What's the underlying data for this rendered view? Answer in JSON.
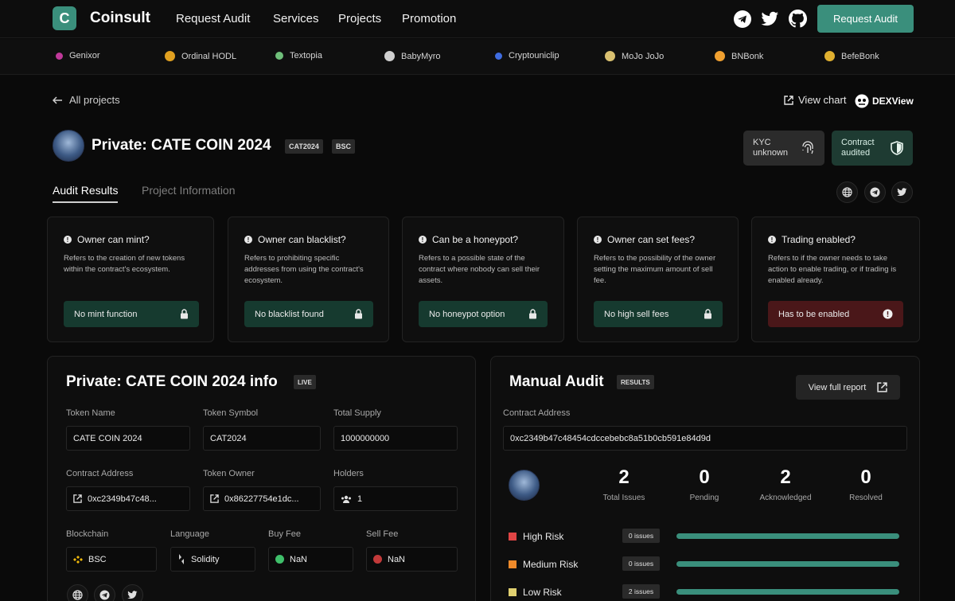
{
  "nav": {
    "brand": "Coinsult",
    "links": [
      "Request Audit",
      "Services",
      "Projects",
      "Promotion"
    ],
    "cta": "Request Audit"
  },
  "ticker": [
    {
      "name": "Genixor",
      "color": "#c0399a"
    },
    {
      "name": "Ordinal HODL",
      "color": "#e0a020"
    },
    {
      "name": "Textopia",
      "color": "#6fbf7a"
    },
    {
      "name": "BabyMyro",
      "color": "#cfcfcf"
    },
    {
      "name": "Cryptouniclip",
      "color": "#3f6ce0"
    },
    {
      "name": "MoJo JoJo",
      "color": "#d9c070"
    },
    {
      "name": "BNBonk",
      "color": "#f0a030"
    },
    {
      "name": "BefeBonk",
      "color": "#e0b030"
    }
  ],
  "header": {
    "back": "All projects",
    "view_chart": "View chart",
    "dexview": "DEXView",
    "title": "Private: CATE COIN 2024",
    "tags": [
      "CAT2024",
      "BSC"
    ],
    "kyc_line1": "KYC",
    "kyc_line2": "unknown",
    "contract_line1": "Contract",
    "contract_line2": "audited"
  },
  "tabs": [
    "Audit Results",
    "Project Information"
  ],
  "checks": [
    {
      "title": "Owner can mint?",
      "desc": "Refers to the creation of new tokens within the contract's ecosystem.",
      "status": "No mint function",
      "ok": true
    },
    {
      "title": "Owner can blacklist?",
      "desc": "Refers to prohibiting specific addresses from using the contract's ecosystem.",
      "status": "No blacklist found",
      "ok": true
    },
    {
      "title": "Can be a honeypot?",
      "desc": "Refers to a possible state of the contract where nobody can sell their assets.",
      "status": "No honeypot option",
      "ok": true
    },
    {
      "title": "Owner can set fees?",
      "desc": "Refers to the possibility of the owner setting the maximum amount of sell fee.",
      "status": "No high sell fees",
      "ok": true
    },
    {
      "title": "Trading enabled?",
      "desc": "Refers to if the owner needs to take action to enable trading, or if trading is enabled already.",
      "status": "Has to be enabled",
      "ok": false
    }
  ],
  "info": {
    "title": "Private: CATE COIN 2024 info",
    "tag": "LIVE",
    "token_name_label": "Token Name",
    "token_name": "CATE COIN 2024",
    "token_symbol_label": "Token Symbol",
    "token_symbol": "CAT2024",
    "total_supply_label": "Total Supply",
    "total_supply": "1000000000",
    "contract_label": "Contract Address",
    "contract": "0xc2349b47c48...",
    "owner_label": "Token Owner",
    "owner": "0x86227754e1dc...",
    "holders_label": "Holders",
    "holders": "1",
    "blockchain_label": "Blockchain",
    "blockchain": "BSC",
    "language_label": "Language",
    "language": "Solidity",
    "buy_fee_label": "Buy Fee",
    "buy_fee": "NaN",
    "sell_fee_label": "Sell Fee",
    "sell_fee": "NaN"
  },
  "audit": {
    "title": "Manual Audit",
    "tag": "RESULTS",
    "full_report": "View full report",
    "contract_label": "Contract Address",
    "contract": "0xc2349b47c48454cdccebebc8a51b0cb591e84d9d",
    "stats": [
      {
        "value": "2",
        "label": "Total Issues"
      },
      {
        "value": "0",
        "label": "Pending"
      },
      {
        "value": "2",
        "label": "Acknowledged"
      },
      {
        "value": "0",
        "label": "Resolved"
      }
    ],
    "risks": [
      {
        "label": "High Risk",
        "count": "0 issues",
        "color": "#e04545"
      },
      {
        "label": "Medium Risk",
        "count": "0 issues",
        "color": "#f08a2a"
      },
      {
        "label": "Low Risk",
        "count": "2 issues",
        "color": "#e0d070"
      }
    ]
  }
}
